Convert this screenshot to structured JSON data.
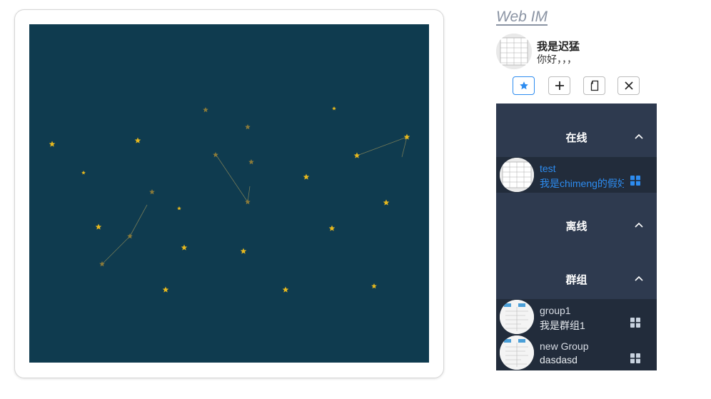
{
  "app": {
    "title": "Web IM"
  },
  "profile": {
    "name": "我是迟猛",
    "signature": "你好，，，"
  },
  "toolbar": {
    "buttons": [
      {
        "name": "favorite-button",
        "icon": "star-icon",
        "active": true
      },
      {
        "name": "add-button",
        "icon": "plus-icon",
        "active": false
      },
      {
        "name": "copy-button",
        "icon": "document-icon",
        "active": false
      },
      {
        "name": "close-button",
        "icon": "close-icon",
        "active": false
      }
    ]
  },
  "groups": {
    "online": {
      "label": "在线",
      "contacts": [
        {
          "name": "test",
          "message": "我是chimeng的假好友"
        }
      ]
    },
    "offline": {
      "label": "离线",
      "contacts": []
    },
    "groups": {
      "label": "群组",
      "contacts": [
        {
          "name": "group1",
          "message": "我是群组1"
        },
        {
          "name": "new Group",
          "message": "dasdasd"
        }
      ]
    }
  },
  "colors": {
    "accent": "#2d8cf0",
    "panel": "#2e3a4f",
    "panel_row": "#222c3b",
    "starfield": "#0f3b4f",
    "star_bright": "#e6b81e",
    "star_dim": "#8a7a3a"
  }
}
